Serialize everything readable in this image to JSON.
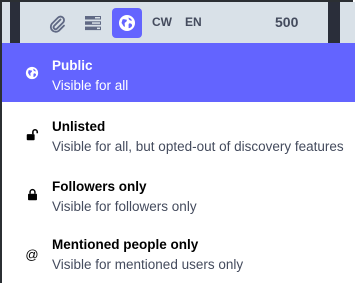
{
  "toolbar": {
    "icons": [
      "paperclip-icon",
      "poll-icon",
      "globe-icon"
    ],
    "cw_label": "CW",
    "lang_label": "EN",
    "char_count": "500"
  },
  "visibility_options": [
    {
      "icon": "globe-icon",
      "title": "Public",
      "subtitle": "Visible for all",
      "selected": true
    },
    {
      "icon": "unlock-icon",
      "title": "Unlisted",
      "subtitle": "Visible for all, but opted-out of discovery features",
      "selected": false
    },
    {
      "icon": "lock-icon",
      "title": "Followers only",
      "subtitle": "Visible for followers only",
      "selected": false
    },
    {
      "icon": "at-icon",
      "title": "Mentioned people only",
      "subtitle": "Visible for mentioned users only",
      "selected": false
    }
  ],
  "colors": {
    "accent": "#6364ff",
    "toolbar_bg": "#d9e1e8",
    "muted_text": "#444b5d"
  }
}
